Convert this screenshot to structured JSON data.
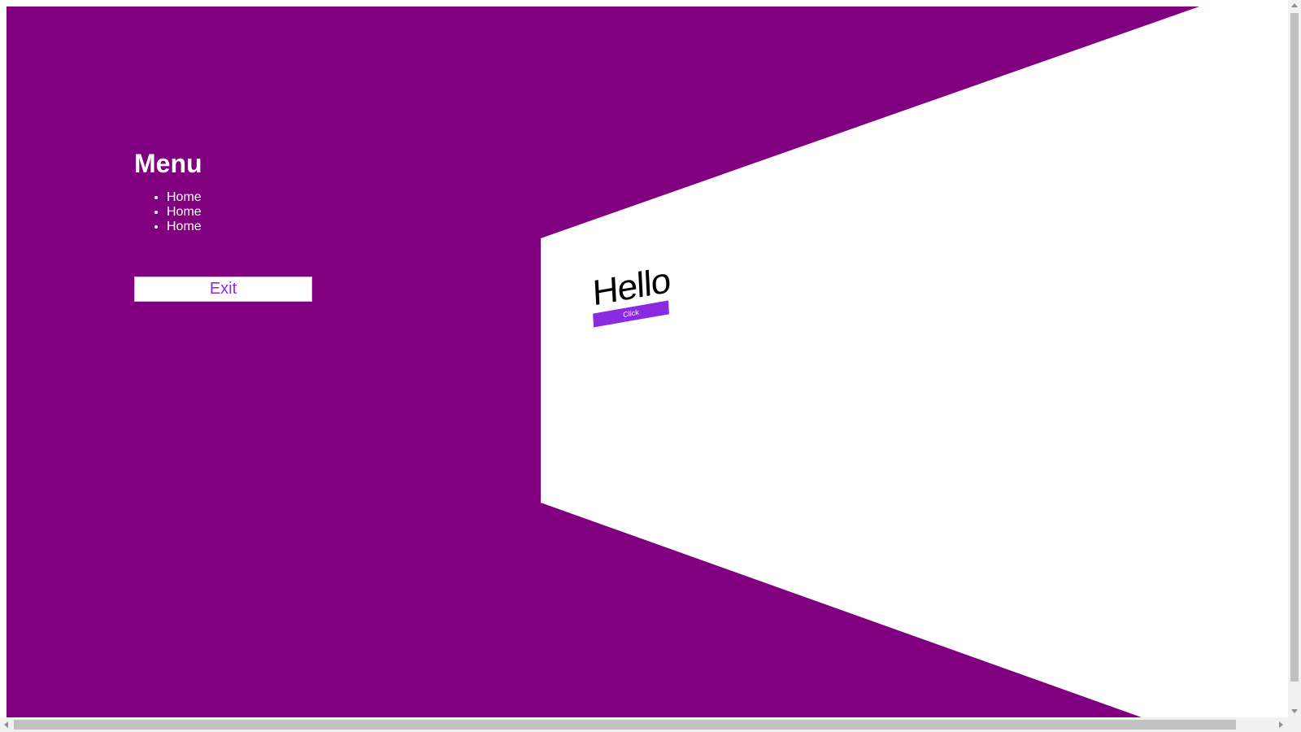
{
  "menu": {
    "title": "Menu",
    "items": [
      {
        "label": "Home"
      },
      {
        "label": "Home"
      },
      {
        "label": "Home"
      }
    ],
    "exit_label": "Exit"
  },
  "content": {
    "hello_text": "Hello",
    "button_label": "Click"
  },
  "colors": {
    "backdrop": "#800080",
    "panel": "#ffffff",
    "accent": "#8a2be2",
    "menu_text": "#ffffff"
  }
}
